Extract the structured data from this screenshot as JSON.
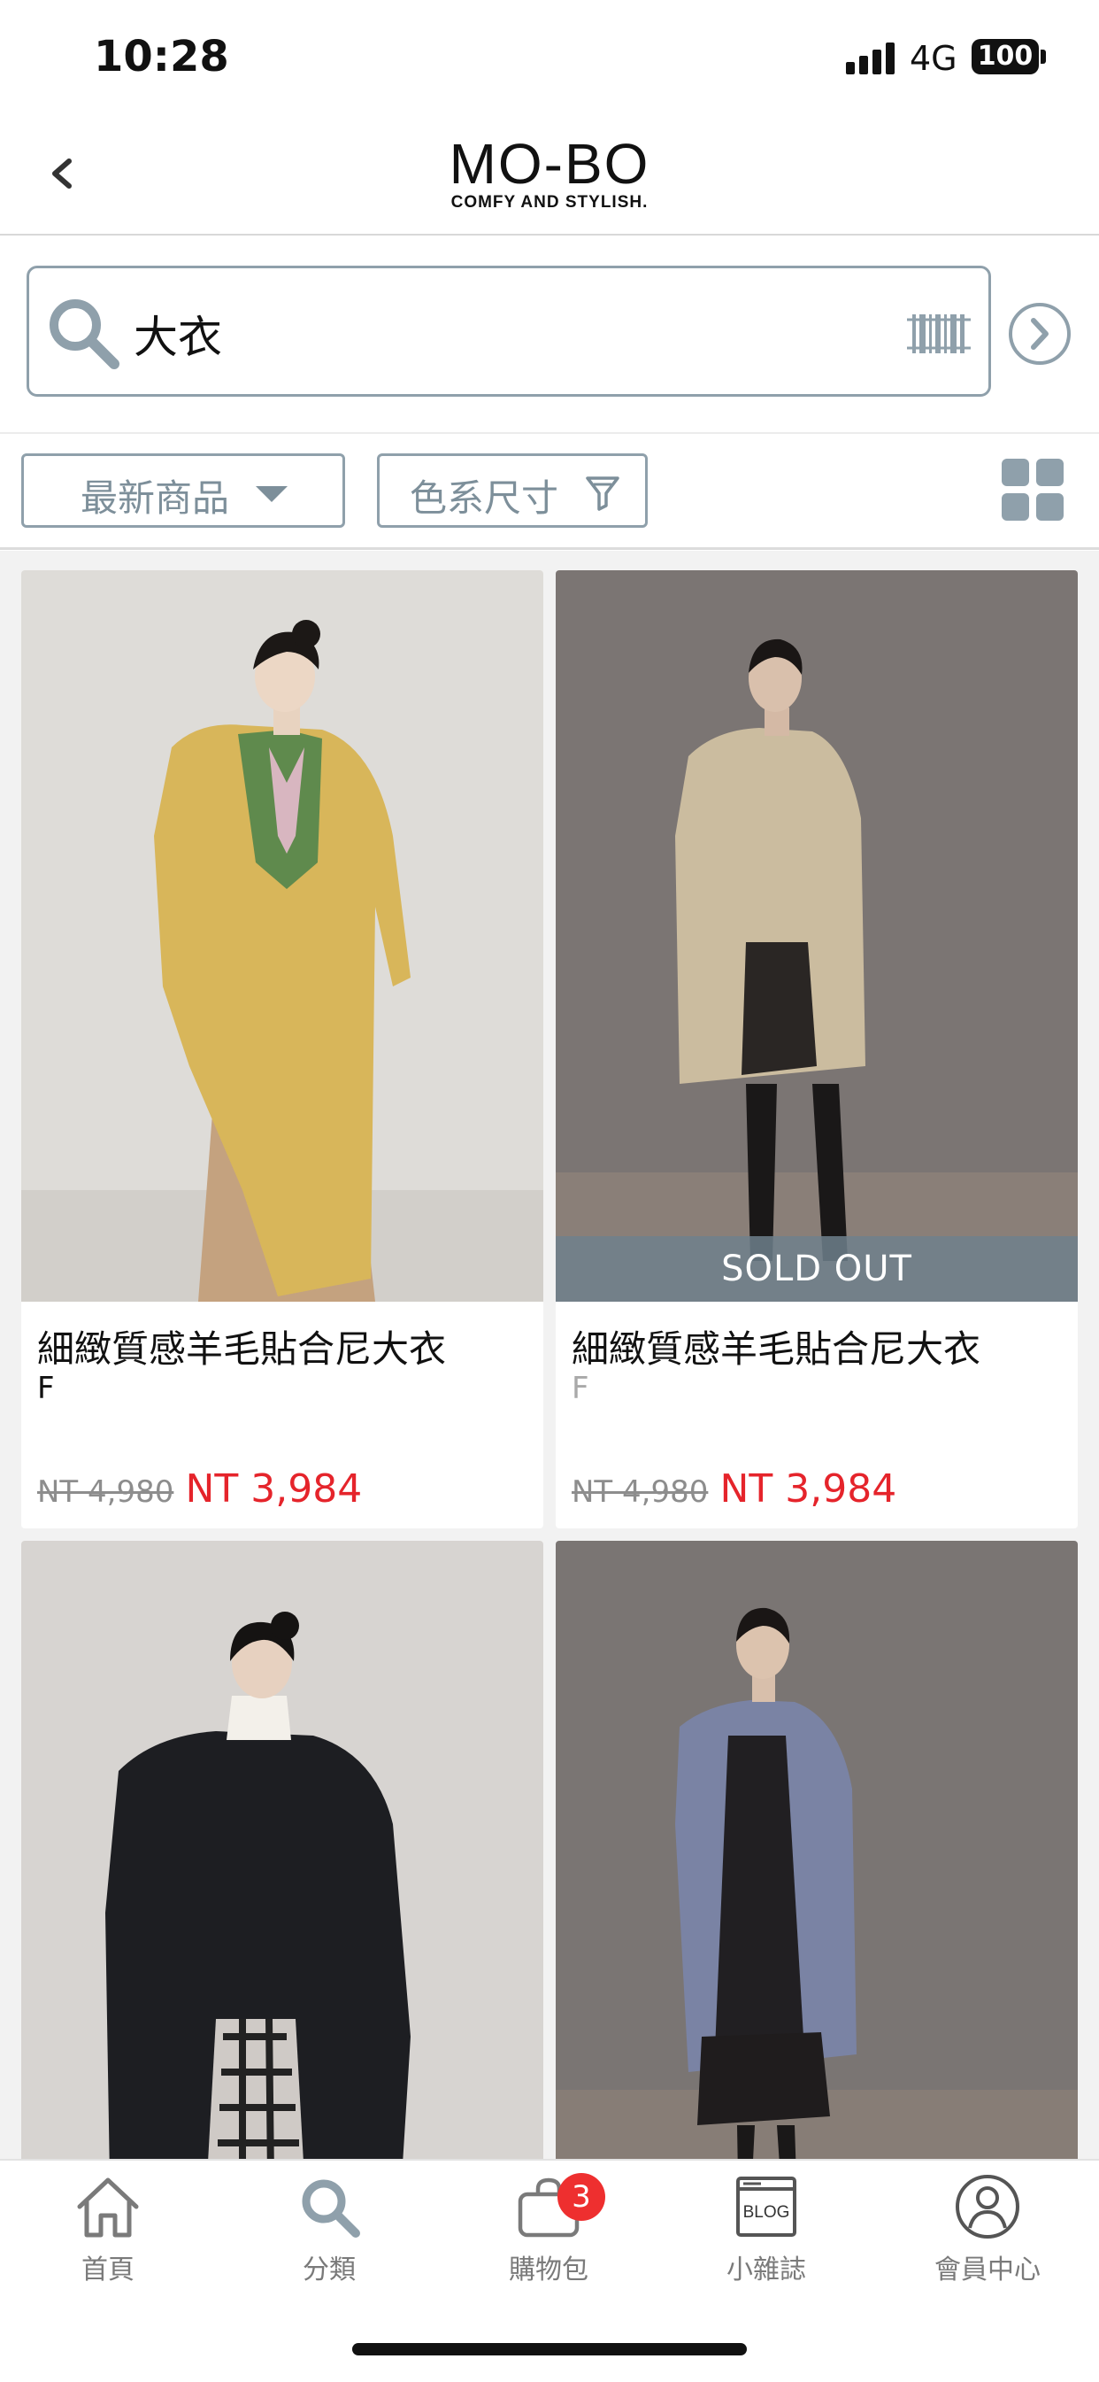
{
  "status_bar": {
    "time": "10:28",
    "network": "4G",
    "battery": "100"
  },
  "header": {
    "logo_main": "MO-BO",
    "logo_sub": "COMFY AND STYLISH."
  },
  "search": {
    "query": "大衣"
  },
  "filters": {
    "sort_label": "最新商品",
    "filter_label": "色系尺寸"
  },
  "products": [
    {
      "name": "細緻質感羊毛貼合尼大衣",
      "size": "F",
      "original_price": "NT 4,980",
      "sale_price": "NT 3,984",
      "sold_out": ""
    },
    {
      "name": "細緻質感羊毛貼合尼大衣",
      "size": "F",
      "original_price": "NT 4,980",
      "sale_price": "NT 3,984",
      "sold_out": "SOLD OUT"
    }
  ],
  "tabs": [
    {
      "label": "首頁",
      "icon": "home-icon"
    },
    {
      "label": "分類",
      "icon": "search-icon"
    },
    {
      "label": "購物包",
      "icon": "shopping-bag-icon",
      "badge": "3"
    },
    {
      "label": "小雜誌",
      "icon": "blog-icon",
      "icon_text": "BLOG"
    },
    {
      "label": "會員中心",
      "icon": "user-icon"
    }
  ],
  "colors": {
    "accent": "#8fa0ab",
    "price_red": "#e5242b",
    "badge_red": "#ee2f2f"
  }
}
